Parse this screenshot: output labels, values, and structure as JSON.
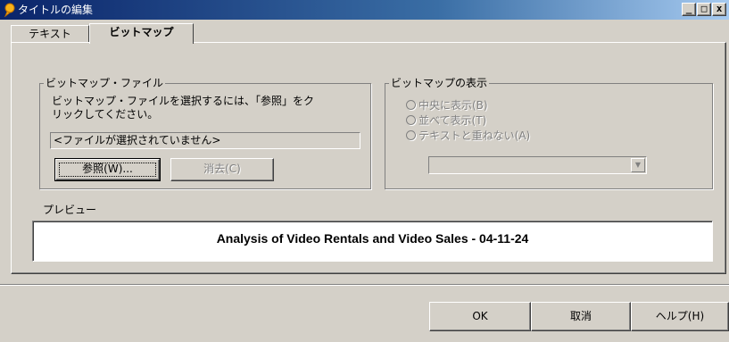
{
  "window": {
    "title": "タイトルの編集",
    "controls": {
      "minimize": "_",
      "maximize": "□",
      "close": "x"
    }
  },
  "tabs": [
    {
      "label": "テキスト",
      "active": false
    },
    {
      "label": "ビットマップ",
      "active": true
    }
  ],
  "bitmap_file": {
    "legend": "ビットマップ・ファイル",
    "instruction_line1": "ビットマップ・ファイルを選択するには、「参照」をク",
    "instruction_line2": "リックしてください。",
    "file_value": "<ファイルが選択されていません>",
    "browse_label": "参照(W)...",
    "clear_label": "消去(C)"
  },
  "bitmap_display": {
    "legend": "ビットマップの表示",
    "options": [
      {
        "label": "中央に表示(B)"
      },
      {
        "label": "並べて表示(T)"
      },
      {
        "label": "テキストと重ねない(A)"
      }
    ],
    "combo_value": ""
  },
  "preview": {
    "label": "プレビュー",
    "text": "Analysis of Video Rentals and Video Sales - 04-11-24"
  },
  "buttons": {
    "ok": "OK",
    "cancel": "取消",
    "help": "ヘルプ(H)"
  },
  "colors": {
    "face": "#d4d0c8",
    "title_gradient_start": "#0a246a",
    "title_gradient_end": "#a6caf0",
    "disabled_text": "#808080"
  }
}
